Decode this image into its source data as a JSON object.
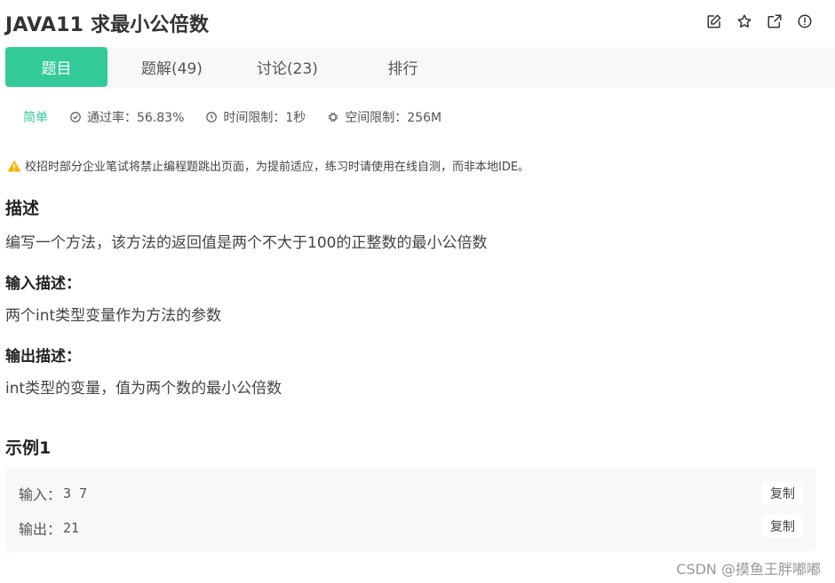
{
  "header": {
    "title": "JAVA11  求最小公倍数",
    "actions": [
      "edit-icon",
      "star-icon",
      "share-icon",
      "report-icon"
    ]
  },
  "tabs": [
    {
      "label": "题目",
      "active": true
    },
    {
      "label": "题解(49)",
      "active": false
    },
    {
      "label": "讨论(23)",
      "active": false
    },
    {
      "label": "排行",
      "active": false
    }
  ],
  "meta": {
    "difficulty": "简单",
    "pass_rate": "通过率：56.83%",
    "time_limit": "时间限制：1秒",
    "space_limit": "空间限制：256M"
  },
  "notice": "校招时部分企业笔试将禁止编程题跳出页面，为提前适应，练习时请使用在线自测，而非本地IDE。",
  "description": {
    "heading": "描述",
    "text": "编写一个方法，该方法的返回值是两个不大于100的正整数的最小公倍数"
  },
  "input_desc": {
    "heading": "输入描述：",
    "text": "两个int类型变量作为方法的参数"
  },
  "output_desc": {
    "heading": "输出描述：",
    "text": "int类型的变量，值为两个数的最小公倍数"
  },
  "example": {
    "heading": "示例1",
    "input_label": "输入：",
    "input_value": "3 7",
    "output_label": "输出：",
    "output_value": "21",
    "copy_label": "复制"
  },
  "watermark": "CSDN @摸鱼王胖嘟嘟",
  "colors": {
    "accent": "#32ca99",
    "warning": "#f5b400",
    "tab_bar_bg": "#f7f8fa"
  }
}
